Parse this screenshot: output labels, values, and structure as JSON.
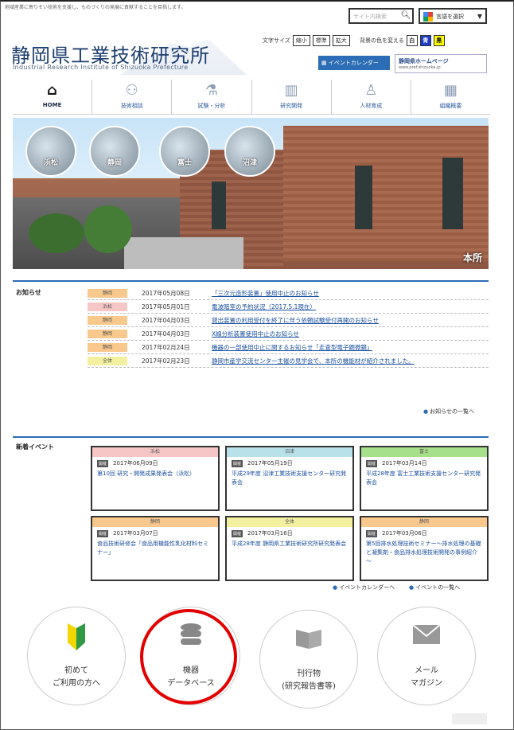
{
  "header": {
    "tagline": "地域産業に寄りそい技術を支援し、ものづくりの発展に貢献することを目指します。",
    "search_placeholder": "サイト内検索",
    "language_button": "言語を選択",
    "logo_text": "静岡県工業技術研究所",
    "logo_en": "Industrial Research Institute of Shizuoka Prefecture",
    "font_size_label": "文字サイズ",
    "font_sizes": [
      "縮小",
      "標準",
      "拡大"
    ],
    "color_label": "背景の色を変える",
    "color_buttons": [
      "白",
      "青",
      "黒"
    ],
    "event_calendar": "イベントカレンダー",
    "pref_home": "静岡県ホームページ",
    "pref_url": "www.pref.shizuoka.jp"
  },
  "nav": {
    "items": [
      {
        "label": "HOME",
        "icon": "home-icon"
      },
      {
        "label": "技術相談",
        "icon": "consult-icon"
      },
      {
        "label": "試験・分析",
        "icon": "analysis-icon"
      },
      {
        "label": "研究開発",
        "icon": "research-icon"
      },
      {
        "label": "人材育成",
        "icon": "training-icon"
      },
      {
        "label": "組織概要",
        "icon": "organization-icon"
      }
    ]
  },
  "hero": {
    "branches": [
      "浜松",
      "静岡",
      "富士",
      "沼津"
    ],
    "main_label": "本所"
  },
  "news": {
    "label": "お知らせ",
    "rows": [
      {
        "tag": "静岡",
        "date": "2017年05月08日",
        "text": "「三次元造形装置」使用中止のお知らせ"
      },
      {
        "tag": "浜松",
        "date": "2017年05月01日",
        "text": "電波暗室の予約状況（2017.5.1現在）"
      },
      {
        "tag": "静岡",
        "date": "2017年04月03日",
        "text": "貸出装置の利用受付を終了に伴う依頼試験受付再開のお知らせ"
      },
      {
        "tag": "静岡",
        "date": "2017年04月03日",
        "text": "X線分析装置使用中止のお知らせ"
      },
      {
        "tag": "静岡",
        "date": "2017年02月24日",
        "text": "機器の一部使用中止に関するお知らせ「走査型電子顕微鏡」"
      },
      {
        "tag": "全体",
        "date": "2017年02月23日",
        "text": "静岡市産学交流センター主催の見学会で、本所の機能材が紹介されました。"
      }
    ],
    "more": "お知らせの一覧へ"
  },
  "events": {
    "label": "新着イベント",
    "cards": [
      {
        "branch": "浜松",
        "badge": "開催",
        "date": "2017年06月09日",
        "title": "第10回 研究・開発成果発表会（浜松）"
      },
      {
        "branch": "沼津",
        "badge": "開催",
        "date": "2017年05月19日",
        "title": "平成29年度 沼津工業技術支援センター研究発表会"
      },
      {
        "branch": "富士",
        "badge": "開催",
        "date": "2017年03月14日",
        "title": "平成28年度 富士工業技術支援センター研究発表会"
      },
      {
        "branch": "静岡",
        "badge": "開催",
        "date": "2017年03月07日",
        "title": "食品技術研修会「食品用機能性乳化材料セミナー」"
      },
      {
        "branch": "全体",
        "badge": "開催",
        "date": "2017年03月16日",
        "title": "平成28年度 静岡県工業技術研究所研究発表会"
      },
      {
        "branch": "静岡",
        "badge": "開催",
        "date": "2017年03月06日",
        "title": "第5回排水処理技術セミナー～排水処理の基礎と凝集剤・食品排水処理技術開発の事例紹介～"
      }
    ],
    "more_calendar": "イベントカレンダーへ",
    "more_list": "イベントの一覧へ"
  },
  "quick_links": [
    {
      "label1": "初めて",
      "label2": "ご利用の方へ",
      "icon": "beginner-leaf-icon"
    },
    {
      "label1": "機器",
      "label2": "データベース",
      "icon": "database-icon"
    },
    {
      "label1": "刊行物",
      "label2": "(研究報告書等)",
      "icon": "book-icon"
    },
    {
      "label1": "メール",
      "label2": "マガジン",
      "icon": "mail-icon"
    }
  ],
  "colors": {
    "accent": "#2d6db5",
    "highlight": "#e30000",
    "tag_shizuoka": "#f9c88c",
    "tag_hamamatsu": "#f6c6c6",
    "tag_numazu": "#b9e1ea",
    "tag_fuji": "#a7e08a",
    "tag_all": "#f3f0a0"
  }
}
